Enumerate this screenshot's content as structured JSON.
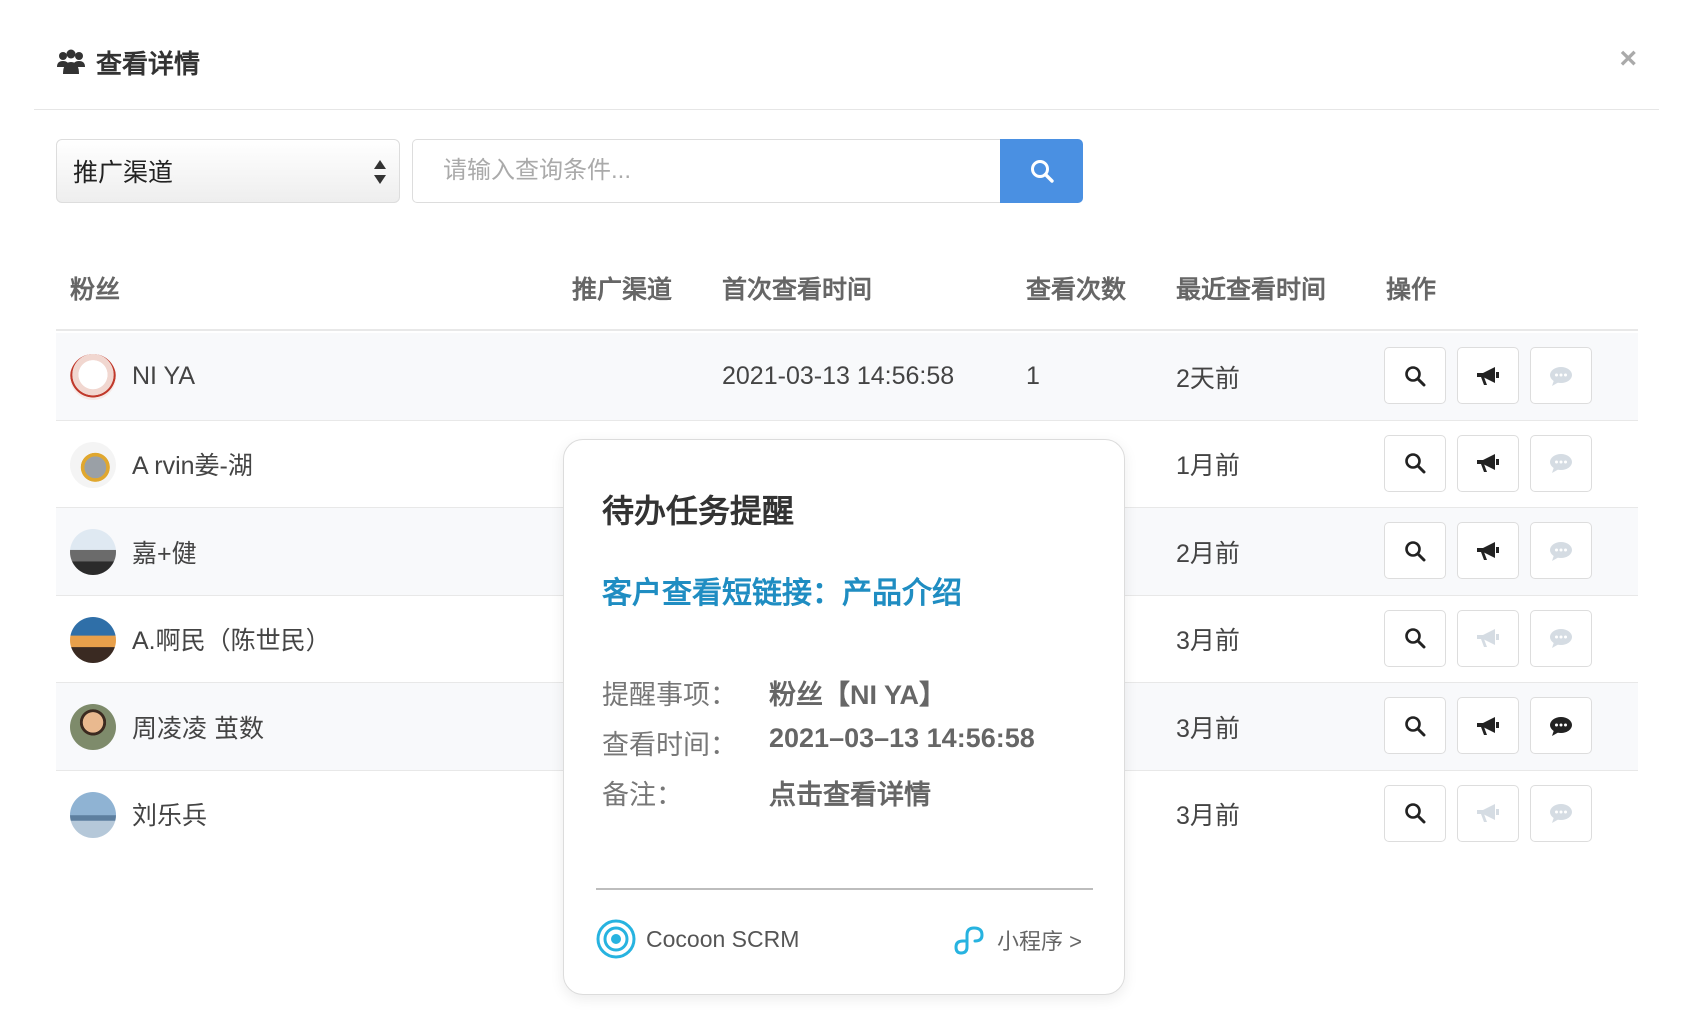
{
  "header": {
    "title": "查看详情",
    "close": "×"
  },
  "filter": {
    "select_value": "推广渠道",
    "search_placeholder": "请输入查询条件..."
  },
  "table": {
    "columns": [
      "粉丝",
      "推广渠道",
      "首次查看时间",
      "查看次数",
      "最近查看时间",
      "操作"
    ],
    "rows": [
      {
        "name": "NI YA",
        "channel": "",
        "first_view": "2021-03-13 14:56:58",
        "count": "1",
        "recent": "2天前",
        "broadcast_enabled": true,
        "chat_enabled": false
      },
      {
        "name": "A rvin姜-湖",
        "channel": "",
        "first_view": "",
        "count": "",
        "recent": "1月前",
        "broadcast_enabled": true,
        "chat_enabled": false
      },
      {
        "name": "嘉+健",
        "channel": "",
        "first_view": "",
        "count": "",
        "recent": "2月前",
        "broadcast_enabled": true,
        "chat_enabled": false
      },
      {
        "name": "A.啊民（陈世民）",
        "channel": "",
        "first_view": "",
        "count": "",
        "recent": "3月前",
        "broadcast_enabled": false,
        "chat_enabled": false
      },
      {
        "name": "周凌凌 茧数",
        "channel": "",
        "first_view": "",
        "count": "",
        "recent": "3月前",
        "broadcast_enabled": true,
        "chat_enabled": true
      },
      {
        "name": "刘乐兵",
        "channel": "",
        "first_view": "",
        "count": "",
        "recent": "3月前",
        "broadcast_enabled": false,
        "chat_enabled": false
      }
    ]
  },
  "popup": {
    "title": "待办任务提醒",
    "link": "客户查看短链接：产品介绍",
    "items": [
      {
        "label": "提醒事项：",
        "value": "粉丝【NI YA】"
      },
      {
        "label": "查看时间：",
        "value": "2021–03–13  14:56:58"
      },
      {
        "label": "备注：",
        "value": "点击查看详情"
      }
    ],
    "brand": "Cocoon SCRM",
    "mini_program": "小程序 >"
  },
  "colors": {
    "primary": "#4a90e2",
    "link": "#1f8dc2",
    "icon_active": "#222222",
    "icon_disabled": "#d5dce3"
  }
}
